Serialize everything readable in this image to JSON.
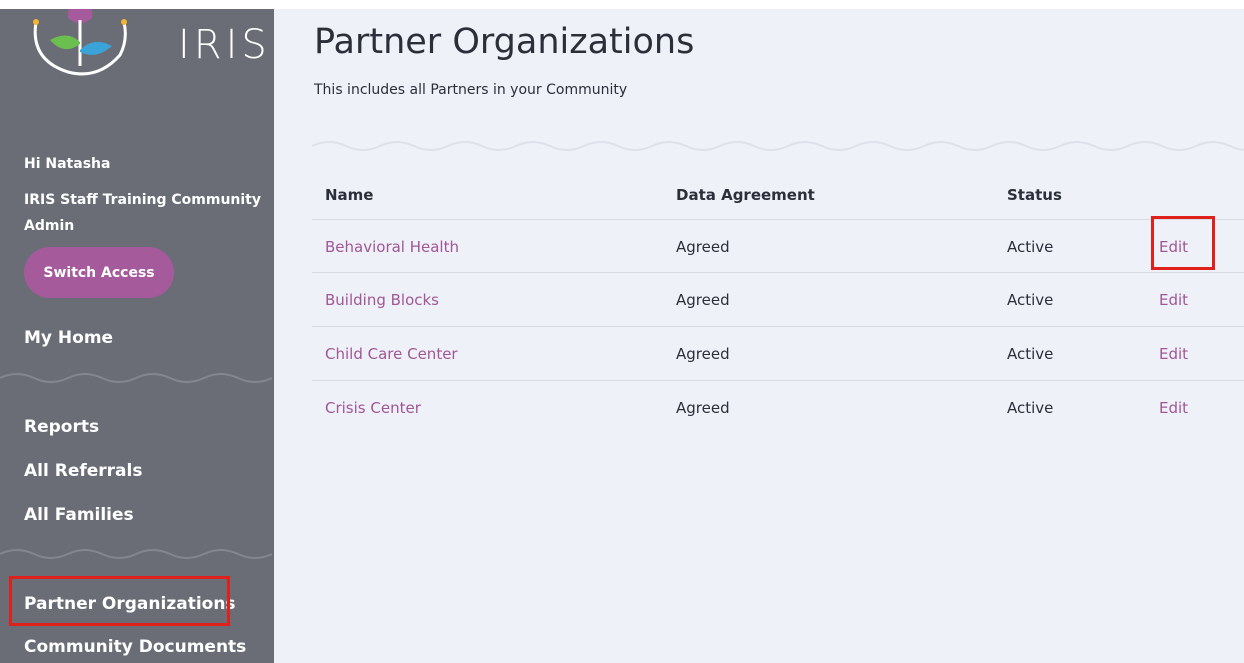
{
  "brand": {
    "name": "IRIS"
  },
  "sidebar": {
    "greeting": "Hi Natasha",
    "role_line1": "IRIS Staff Training Community",
    "role_line2": "Admin",
    "switch_access": "Switch Access",
    "nav": {
      "my_home": "My Home",
      "reports": "Reports",
      "all_referrals": "All Referrals",
      "all_families": "All Families",
      "partner_organizations": "Partner Organizations",
      "community_documents": "Community Documents"
    }
  },
  "page": {
    "title": "Partner Organizations",
    "subtitle": "This includes all Partners in your Community"
  },
  "table": {
    "headers": {
      "name": "Name",
      "data_agreement": "Data Agreement",
      "status": "Status"
    },
    "rows": [
      {
        "name": "Behavioral Health",
        "agreement": "Agreed",
        "status": "Active",
        "action": "Edit"
      },
      {
        "name": "Building Blocks",
        "agreement": "Agreed",
        "status": "Active",
        "action": "Edit"
      },
      {
        "name": "Child Care Center",
        "agreement": "Agreed",
        "status": "Active",
        "action": "Edit"
      },
      {
        "name": "Crisis Center",
        "agreement": "Agreed",
        "status": "Active",
        "action": "Edit"
      }
    ]
  },
  "colors": {
    "sidebar": "#6a6d76",
    "accent": "#a55a9c",
    "link": "#a05796",
    "highlight": "#e0201b",
    "background": "#eff1f8"
  }
}
